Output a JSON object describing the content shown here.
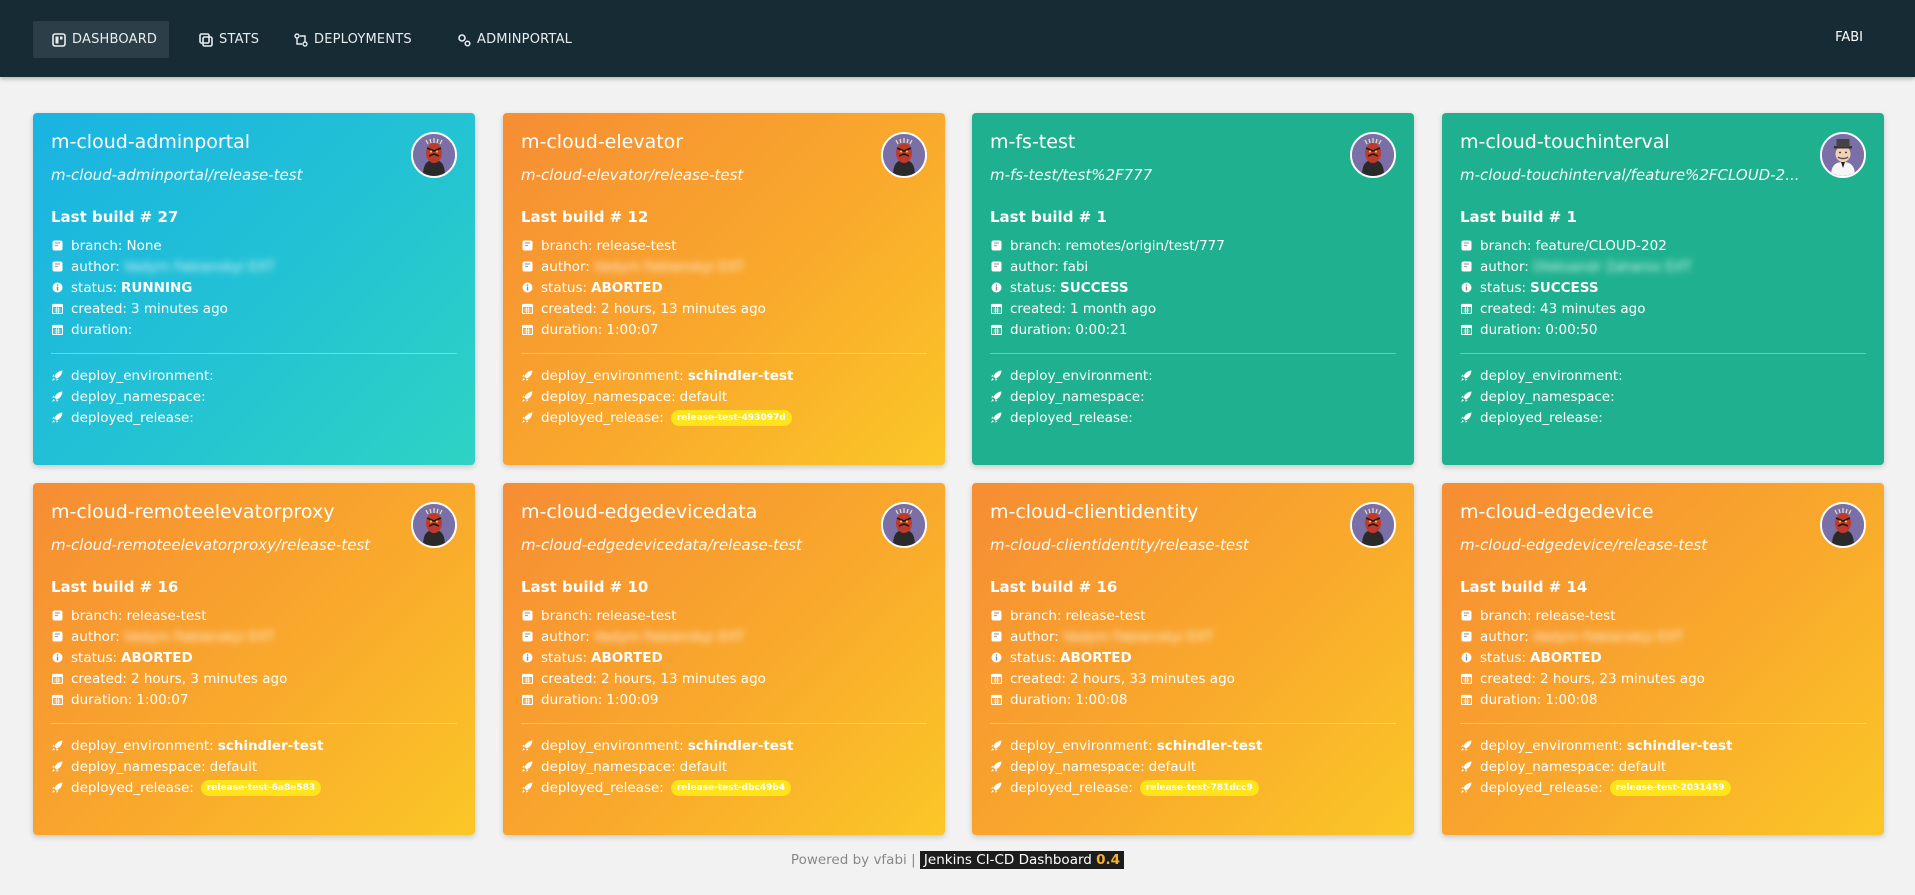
{
  "nav": {
    "items": [
      {
        "label": "DASHBOARD",
        "icon": "dashboard-icon",
        "active": true
      },
      {
        "label": "STATS",
        "icon": "stats-icon"
      },
      {
        "label": "DEPLOYMENTS",
        "icon": "git-compare-icon"
      },
      {
        "label": "ADMINPORTAL",
        "icon": "cogs-icon"
      }
    ],
    "user": "FABI"
  },
  "labels": {
    "last_build": "Last build # ",
    "branch": "branch:",
    "author": "author:",
    "status": "status:",
    "created": "created:",
    "duration": "duration:",
    "deploy_environment": "deploy_environment:",
    "deploy_namespace": "deploy_namespace:",
    "deployed_release": "deployed_release:"
  },
  "cards": [
    {
      "color": "blue",
      "title": "m-cloud-adminportal",
      "subtitle": "m-cloud-adminportal/release-test",
      "build": "27",
      "branch": "None",
      "author": "Vadym Fabianskyi EXT",
      "status": "RUNNING",
      "created": "3 minutes ago",
      "duration": "",
      "env": "",
      "namespace": "",
      "release": ""
    },
    {
      "color": "orange",
      "title": "m-cloud-elevator",
      "subtitle": "m-cloud-elevator/release-test",
      "build": "12",
      "branch": "release-test",
      "author": "Vadym Fabianskyi EXT",
      "status": "ABORTED",
      "created": "2 hours, 13 minutes ago",
      "duration": "1:00:07",
      "env": "schindler-test",
      "namespace": "default",
      "release": "release-test-493097d"
    },
    {
      "color": "green",
      "title": "m-fs-test",
      "subtitle": "m-fs-test/test%2F777",
      "build": "1",
      "branch": "remotes/origin/test/777",
      "author": "fabi",
      "status": "SUCCESS",
      "created": "1 month ago",
      "duration": "0:00:21",
      "env": "",
      "namespace": "",
      "release": ""
    },
    {
      "color": "green",
      "title": "m-cloud-touchinterval",
      "subtitle": "m-cloud-touchinterval/feature%2FCLOUD-2...",
      "build": "1",
      "branch": "feature/CLOUD-202",
      "author": "Oleksandr Zaharov EXT",
      "status": "SUCCESS",
      "created": "43 minutes ago",
      "duration": "0:00:50",
      "env": "",
      "namespace": "",
      "release": ""
    },
    {
      "color": "orange",
      "title": "m-cloud-remoteelevatorproxy",
      "subtitle": "m-cloud-remoteelevatorproxy/release-test",
      "build": "16",
      "branch": "release-test",
      "author": "Vadym Fabianskyi EXT",
      "status": "ABORTED",
      "created": "2 hours, 3 minutes ago",
      "duration": "1:00:07",
      "env": "schindler-test",
      "namespace": "default",
      "release": "release-test-6a8e583"
    },
    {
      "color": "orange",
      "title": "m-cloud-edgedevicedata",
      "subtitle": "m-cloud-edgedevicedata/release-test",
      "build": "10",
      "branch": "release-test",
      "author": "Vadym Fabianskyi EXT",
      "status": "ABORTED",
      "created": "2 hours, 13 minutes ago",
      "duration": "1:00:09",
      "env": "schindler-test",
      "namespace": "default",
      "release": "release-test-dbc49b4"
    },
    {
      "color": "orange",
      "title": "m-cloud-clientidentity",
      "subtitle": "m-cloud-clientidentity/release-test",
      "build": "16",
      "branch": "release-test",
      "author": "Vadym Fabianskyi EXT",
      "status": "ABORTED",
      "created": "2 hours, 33 minutes ago",
      "duration": "1:00:08",
      "env": "schindler-test",
      "namespace": "default",
      "release": "release-test-781dcc9"
    },
    {
      "color": "orange",
      "title": "m-cloud-edgedevice",
      "subtitle": "m-cloud-edgedevice/release-test",
      "build": "14",
      "branch": "release-test",
      "author": "Vadym Fabianskyi EXT",
      "status": "ABORTED",
      "created": "2 hours, 23 minutes ago",
      "duration": "1:00:08",
      "env": "schindler-test",
      "namespace": "default",
      "release": "release-test-2031459"
    }
  ],
  "footer": {
    "powered_by": "Powered by vfabi |",
    "product": "Jenkins CI-CD Dashboard",
    "version": "0.4"
  }
}
